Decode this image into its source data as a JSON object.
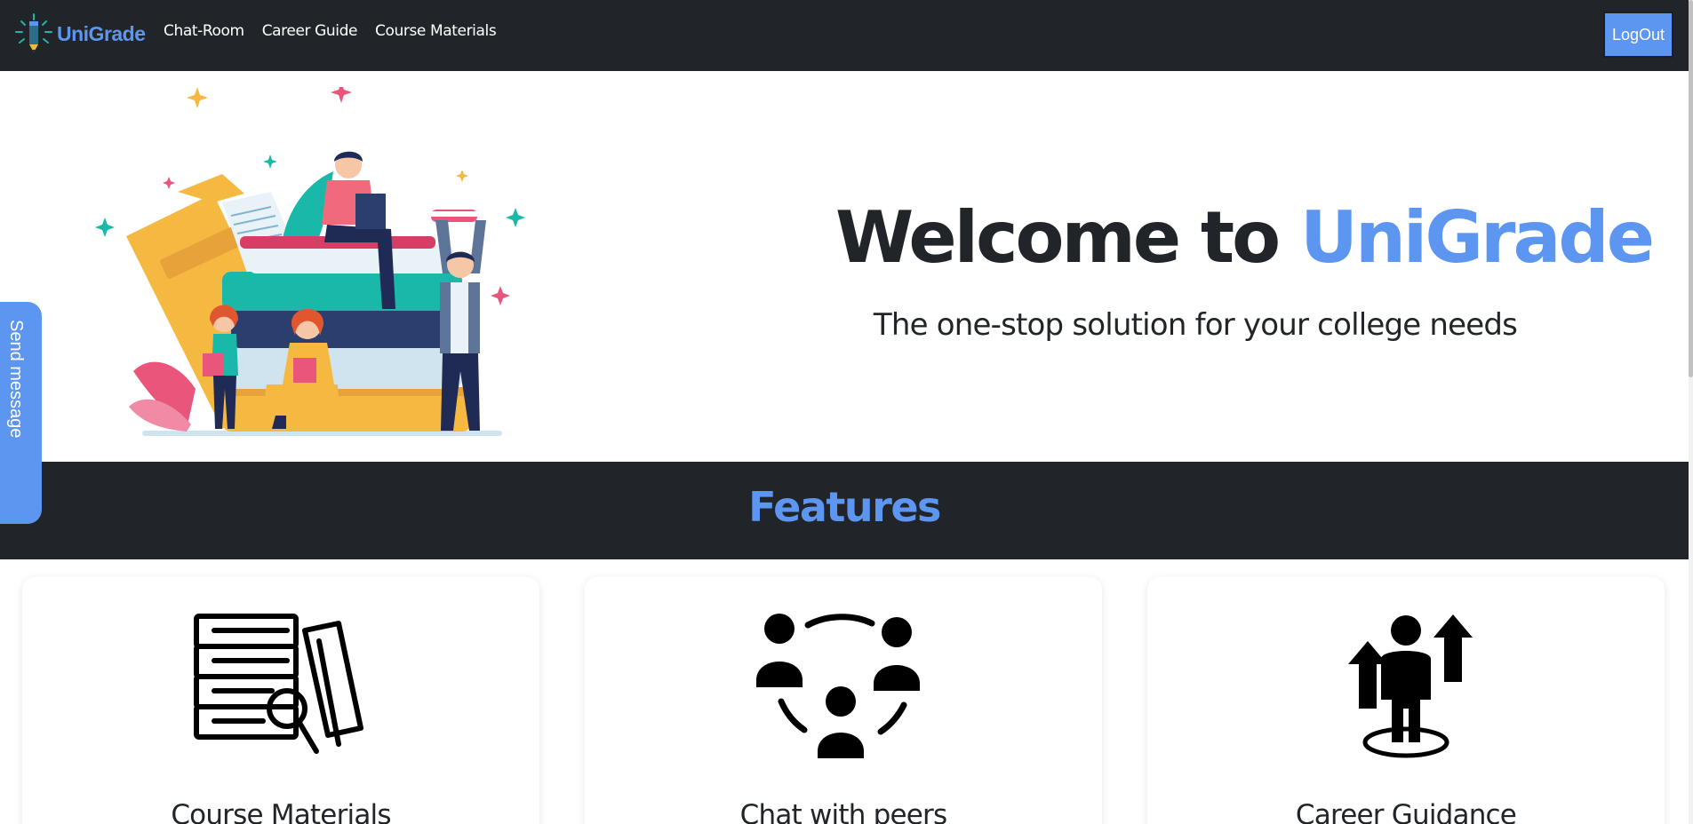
{
  "navbar": {
    "brand": "UniGrade",
    "links": [
      "Chat-Room",
      "Career Guide",
      "Course Materials"
    ],
    "logout_label": "LogOut"
  },
  "hero": {
    "welcome_prefix": "Welcome to ",
    "welcome_brand": "UniGrade",
    "tagline": "The one-stop solution for your college needs"
  },
  "features": {
    "title": "Features",
    "cards": [
      {
        "title": "Course Materials",
        "icon": "books-search-icon"
      },
      {
        "title": "Chat with peers",
        "icon": "people-network-icon"
      },
      {
        "title": "Career Guidance",
        "icon": "career-growth-icon"
      }
    ]
  },
  "send_message_label": "Send message",
  "colors": {
    "accent": "#5c96f0",
    "dark": "#212529",
    "white": "#ffffff"
  }
}
